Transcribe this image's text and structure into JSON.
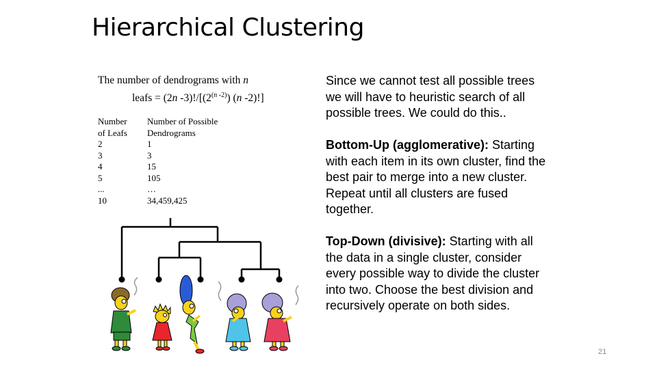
{
  "title": "Hierarchical Clustering",
  "formula": {
    "line1_pre": "The number of dendrograms with ",
    "line1_var": "n",
    "line2_pre": "leafs  = (2",
    "line2_var1": "n",
    "line2_mid1": " -3)!/[(2",
    "line2_sup_open": "(",
    "line2_sup_var": "n",
    "line2_sup_rest": " -2)",
    "line2_mid2": ") (",
    "line2_var2": "n",
    "line2_end": " -2)!]"
  },
  "table": {
    "headers": [
      [
        "Number",
        "Number of Possible"
      ],
      [
        "of Leafs",
        "Dendrograms"
      ]
    ],
    "rows": [
      [
        "2",
        "1"
      ],
      [
        "3",
        "3"
      ],
      [
        "4",
        "15"
      ],
      [
        "5",
        "105"
      ],
      [
        "...",
        "…"
      ],
      [
        "10",
        "34,459,425"
      ]
    ]
  },
  "right": {
    "intro": "Since we cannot test all possible trees we will have to heuristic search of all possible trees. We could do this..",
    "bottom_up_label": "Bottom-Up (agglomerative):",
    "bottom_up_text": " Starting with each item in its own cluster, find the best pair to merge into a new cluster. Repeat until all clusters are fused together.",
    "top_down_label": "Top-Down (divisive):",
    "top_down_text": " Starting with all the data in a single cluster, consider every possible way to divide the cluster into two. Choose the best division and recursively operate on both sides."
  },
  "page_number": "21",
  "colors": {
    "line": "#000000",
    "skin": "#f6d21c",
    "green_dress": "#2e8b3a",
    "red_dress": "#e8262c",
    "blue_hair": "#2a5bd7",
    "purple_hair": "#a8a0d8",
    "cyan_dress": "#4fc3e8",
    "pink_dress": "#e84060"
  }
}
